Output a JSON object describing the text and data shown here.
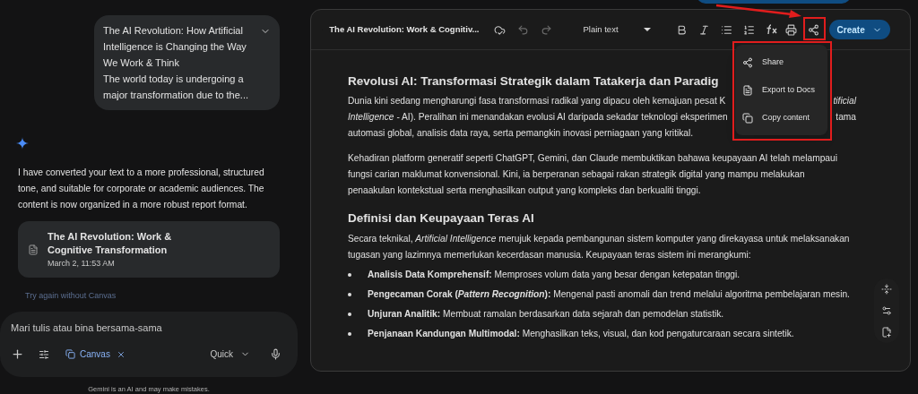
{
  "chat": {
    "user_message": {
      "title": "The AI Revolution: How Artificial Intelligence is Changing the Way We Work & Think",
      "preview": "The world today is undergoing a major transformation due to the..."
    },
    "reply": "I have converted your text to a more professional, structured tone, and suitable for corporate or academic audiences. The content is now organized in a more robust report format.",
    "document_card": {
      "title": "The AI Revolution: Work & Cognitive Transformation",
      "date": "March 2, 11:53 AM"
    },
    "retry_link": "Try again without Canvas",
    "prompt": {
      "placeholder": "Mari tulis atau bina bersama-sama",
      "tool_chip": "Canvas",
      "mode": "Quick"
    },
    "disclaimer": "Gemini is an AI and may make mistakes."
  },
  "canvas": {
    "title": "The AI Revolution: Work & Cognitiv...",
    "format": "Plain text",
    "create_button": "Create",
    "menu": [
      {
        "kind": "share",
        "label": "Share"
      },
      {
        "kind": "export",
        "label": "Export to Docs"
      },
      {
        "kind": "copy",
        "label": "Copy content"
      }
    ],
    "heading": "Revolusi AI: Transformasi Strategik dalam Tatakerja dan Paradig",
    "intro_lines": [
      {
        "left": "Dunia kini sedang mengharungi fasa transformasi radikal yang dipacu oleh kemajuan pesat K",
        "right": "*tificial*"
      },
      {
        "left": "*Intelligence* - AI). Peralihan ini menandakan evolusi AI daripada sekadar teknologi eksperimen",
        "right": "tama"
      },
      {
        "left": "automasi global, analisis data raya, serta pemangkin inovasi perniagaan yang kritikal."
      }
    ],
    "paragraph": "Kehadiran platform generatif seperti ChatGPT, Gemini, dan Claude membuktikan bahawa keupayaan AI telah melampaui fungsi carian maklumat konvensional. Kini, ia berperanan sebagai rakan strategik digital yang mampu melakukan penaakulan kontekstual serta menghasilkan output yang kompleks dan berkualiti tinggi.",
    "subheading": "Definisi dan Keupayaan Teras AI",
    "definition": "Secara teknikal, *Artificial Intelligence* merujuk kepada pembangunan sistem komputer yang direkayasa untuk melaksanakan tugasan yang lazimnya memerlukan kecerdasan manusia. Keupayaan teras sistem ini merangkumi:",
    "bullets": [
      {
        "label": "Analisis Data Komprehensif:",
        "text": "Memproses volum data yang besar dengan ketepatan tinggi."
      },
      {
        "label": "Pengecaman Corak (*Pattern Recognition*):",
        "text": "Mengenal pasti anomali dan trend melalui algoritma pembelajaran mesin."
      },
      {
        "label": "Unjuran Analitik:",
        "text": "Membuat ramalan berdasarkan data sejarah dan pemodelan statistik."
      },
      {
        "label": "Penjanaan Kandungan Multimodal:",
        "text": "Menghasilkan teks, visual, dan kod pengaturcaraan secara sintetik."
      }
    ]
  }
}
